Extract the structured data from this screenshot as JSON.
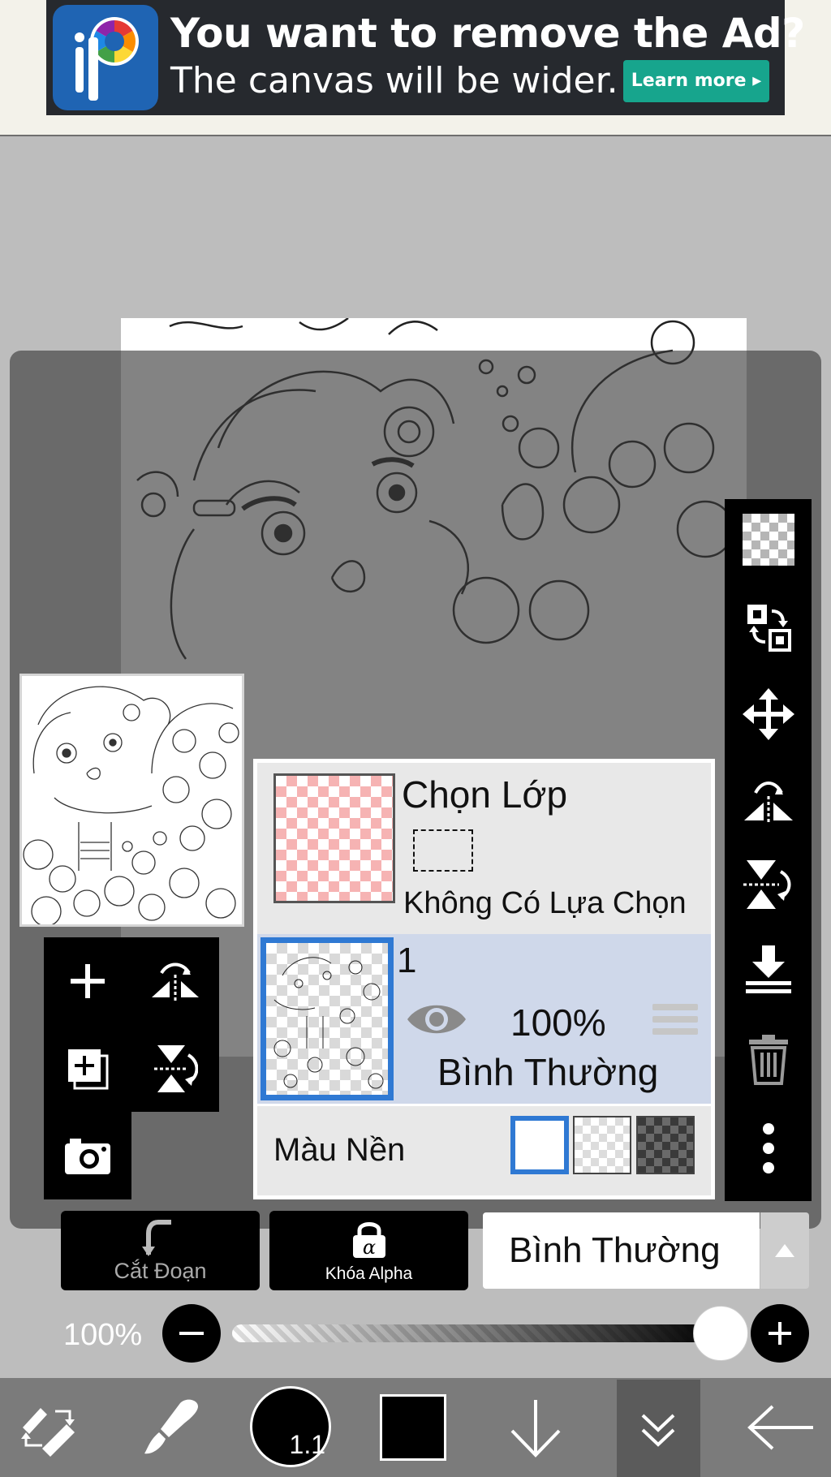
{
  "ad": {
    "title": "You want to remove the Ad?",
    "subtitle": "The canvas will be wider.",
    "cta": "Learn more"
  },
  "right_toolbar": {
    "icons": [
      "transparency-grid-icon",
      "swap-layer-icon",
      "move-icon",
      "flip-horizontal-icon",
      "flip-vertical-icon",
      "merge-down-icon",
      "trash-icon",
      "more-vertical-icon"
    ]
  },
  "left_toolbar": {
    "icons": [
      "add-layer-icon",
      "flip-layer-horizontal-icon",
      "duplicate-layer-icon",
      "flip-layer-vertical-icon",
      "camera-icon"
    ]
  },
  "layers": {
    "selection_layer": {
      "title": "Chọn Lớp",
      "status": "Không Có Lựa Chọn"
    },
    "items": [
      {
        "name": "1",
        "opacity": "100%",
        "blend_mode": "Bình Thường",
        "visible": true,
        "selected": true
      }
    ],
    "background": {
      "label": "Màu Nền",
      "options": [
        "white",
        "light-checker",
        "dark-checker"
      ],
      "selected": "white"
    }
  },
  "layer_options": {
    "clipping_label": "Cắt Đoạn",
    "alpha_lock_label": "Khóa Alpha",
    "blend_mode": "Bình Thường"
  },
  "opacity": {
    "label": "100%",
    "value": 1.0
  },
  "bottom_bar": {
    "brush_size": "1.1",
    "color": "#000000"
  },
  "colors": {
    "accent": "#2f79d3",
    "selected_layer_bg": "#cfd8ea",
    "panel_bg": "#e8e8e8",
    "ad_button": "#17a58d"
  }
}
